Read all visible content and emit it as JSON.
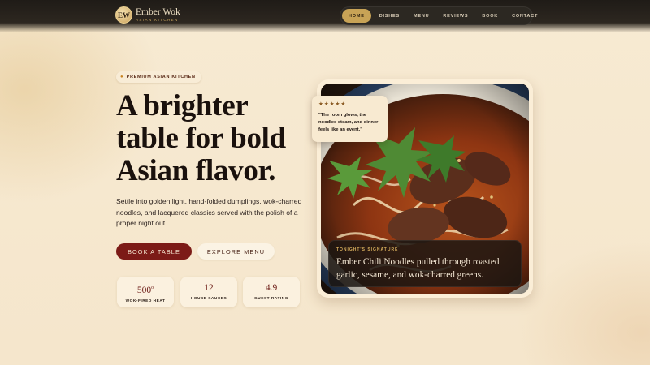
{
  "brand": {
    "initials": "EW",
    "name": "Ember Wok",
    "subtitle": "ASIAN KITCHEN"
  },
  "nav": {
    "items": [
      "HOME",
      "DISHES",
      "MENU",
      "REVIEWS",
      "BOOK",
      "CONTACT"
    ],
    "active": "HOME"
  },
  "hero": {
    "eyebrow": "PREMIUM ASIAN KITCHEN",
    "headline": [
      "A brighter",
      "table for bold",
      "Asian flavor."
    ],
    "description": "Settle into golden light, hand-folded dumplings, wok-charred noodles, and lacquered classics served with the polish of a proper night out.",
    "primary_cta": "BOOK A TABLE",
    "secondary_cta": "EXPLORE MENU"
  },
  "stats": [
    {
      "value": "500",
      "suffix": "o",
      "label": "WOK-FIRED HEAT"
    },
    {
      "value": "12",
      "suffix": "",
      "label": "HOUSE SAUCES"
    },
    {
      "value": "4.9",
      "suffix": "",
      "label": "GUEST RATING"
    }
  ],
  "review": {
    "stars": "★★★★★",
    "rating": 5,
    "quote": "\"The room glows, the noodles steam, and dinner feels like an event.\""
  },
  "signature": {
    "label": "TONIGHT'S SIGNATURE",
    "text": "Ember Chili Noodles pulled through roasted garlic, sesame, and wok-charred greens."
  },
  "colors": {
    "background": "#f6e8cf",
    "accent_red": "#7c1b17",
    "gold": "#c8a356",
    "nav_bg": "#2c2822"
  }
}
